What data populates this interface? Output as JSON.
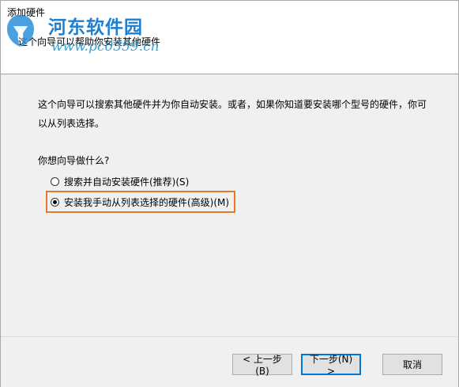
{
  "window": {
    "title": "添加硬件",
    "subtitle": "这个向导可以帮助你安装其他硬件"
  },
  "watermark": {
    "name": "河东软件园",
    "url": "www.pc0359.cn"
  },
  "main": {
    "description": "这个向导可以搜索其他硬件并为你自动安装。或者，如果你知道要安装哪个型号的硬件，你可以从列表选择。",
    "question": "你想向导做什么?",
    "options": [
      {
        "label": "搜索并自动安装硬件(推荐)(S)",
        "selected": false
      },
      {
        "label": "安装我手动从列表选择的硬件(高级)(M)",
        "selected": true
      }
    ],
    "highlight_color": "#e2792c"
  },
  "buttons": {
    "back": "< 上一步(B)",
    "next": "下一步(N) >",
    "cancel": "取消"
  }
}
